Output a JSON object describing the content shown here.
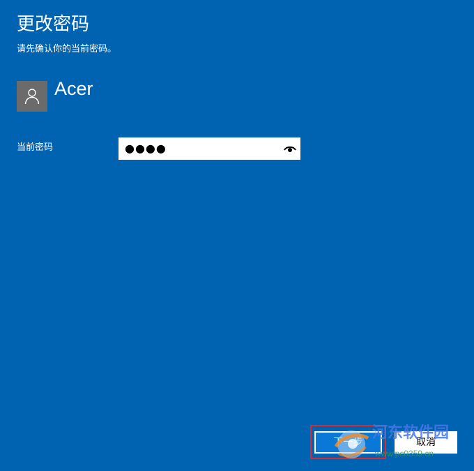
{
  "dialog": {
    "title": "更改密码",
    "subtitle": "请先确认你的当前密码。"
  },
  "user": {
    "name": "Acer",
    "avatar_icon": "person-icon"
  },
  "password_field": {
    "label": "当前密码",
    "value": "●●●●",
    "reveal_icon": "eye-icon"
  },
  "buttons": {
    "next_label": "下一步",
    "cancel_label": "取消"
  },
  "watermark": {
    "text": "河东软件园",
    "url": "www.pc0359.cn"
  },
  "colors": {
    "background": "#0063b1",
    "highlight": "#d92b2b",
    "primary_button": "#0a78d7"
  }
}
